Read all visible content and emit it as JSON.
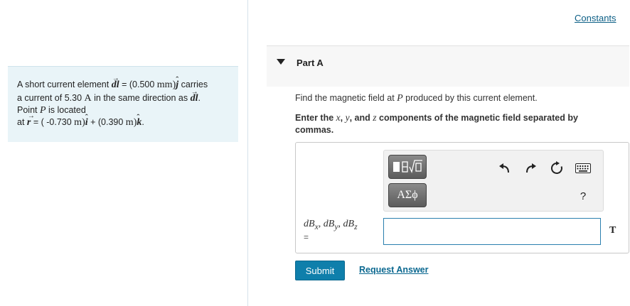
{
  "header": {
    "constants_link": "Constants"
  },
  "problem": {
    "line1": {
      "pre": "A short current element",
      "dl": "dl",
      "eq_pre": " = (0.500 ",
      "unit": "mm",
      "dir": "j",
      "post": " carries"
    },
    "line2": {
      "pre": "a current of 5.30 ",
      "unit": "A",
      "mid": " in the same direction as ",
      "dl": "dl",
      "post": "."
    },
    "line3": {
      "pre": "Point ",
      "var": "P",
      "post": " is located"
    },
    "line4": {
      "pre": "at ",
      "r": "r",
      "eq_pre": " = ( -0.730 ",
      "unit1": "m",
      "dir1": "i",
      "mid": " + (0.390 ",
      "unit2": "m",
      "dir2": "k",
      "post": "."
    }
  },
  "part": {
    "title": "Part A",
    "prompt_pre": "Find the magnetic field at ",
    "prompt_var": "P",
    "prompt_post": " produced by this current element.",
    "instruction": {
      "pre": "Enter the ",
      "x": "x",
      "c1": ", ",
      "y": "y",
      "c2": ", and ",
      "z": "z",
      "post": " components of the magnetic field separated by commas."
    }
  },
  "toolbar": {
    "templates_icon": "templates-icon",
    "symbols_label": "ΑΣϕ",
    "help_label": "?"
  },
  "answer": {
    "label": "dB<sub>x</sub>, dB<sub>y</sub>, dB<sub>z</sub>",
    "label_parts": [
      "dB",
      "x",
      ", dB",
      "y",
      ", dB",
      "z"
    ],
    "equals": "=",
    "value": "",
    "unit": "T"
  },
  "actions": {
    "submit": "Submit",
    "request": "Request Answer"
  },
  "colors": {
    "accent": "#0f7fab",
    "link": "#0b6890",
    "problem_bg": "#e9f4f8"
  }
}
